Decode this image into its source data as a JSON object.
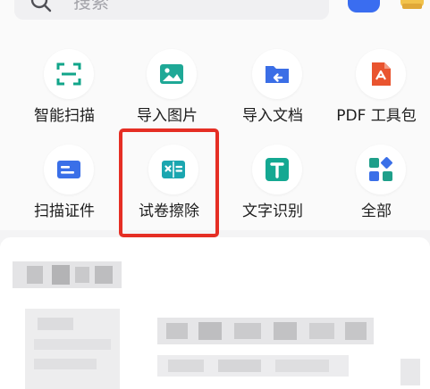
{
  "search": {
    "placeholder": "搜索"
  },
  "tools_row1": [
    {
      "label": "智能扫描",
      "icon": "scan-frame-icon"
    },
    {
      "label": "导入图片",
      "icon": "image-icon"
    },
    {
      "label": "导入文档",
      "icon": "folder-import-icon"
    },
    {
      "label": "PDF 工具包",
      "icon": "pdf-icon"
    }
  ],
  "tools_row2": [
    {
      "label": "扫描证件",
      "icon": "id-card-icon"
    },
    {
      "label": "试卷擦除",
      "icon": "exam-erase-icon"
    },
    {
      "label": "文字识别",
      "icon": "text-recognition-icon"
    },
    {
      "label": "全部",
      "icon": "all-apps-icon"
    }
  ],
  "colors": {
    "scan": "#12a58a",
    "image": "#1ea896",
    "folder": "#3b6ee6",
    "pdf": "#e9542f",
    "idcard": "#3a6fe8",
    "exam": "#1ba6b0",
    "text": "#14a892",
    "all": "#1f9f8a",
    "highlight": "#e52e24"
  }
}
